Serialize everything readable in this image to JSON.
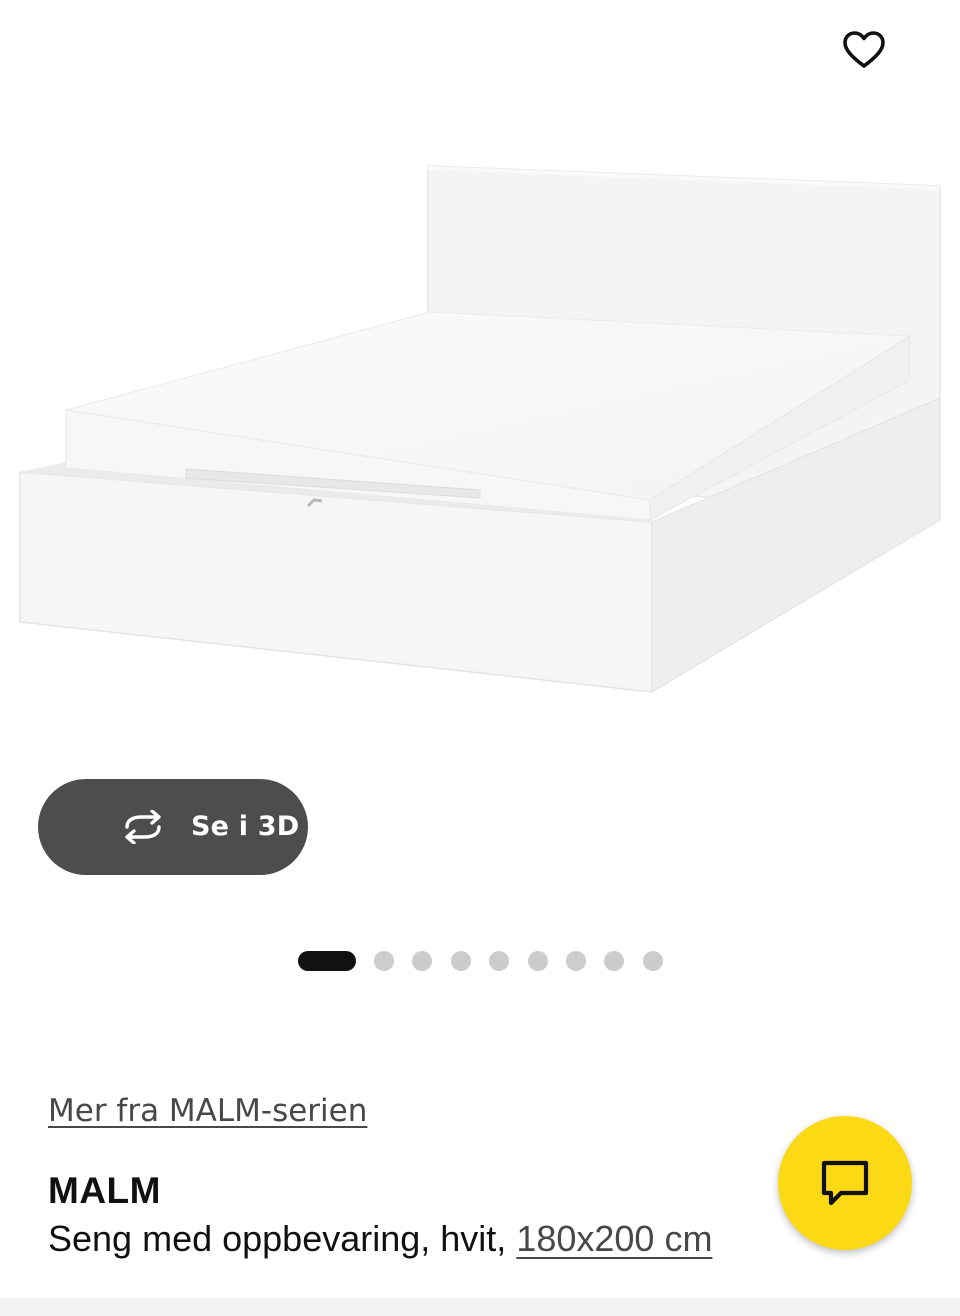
{
  "favorite": {
    "icon": "heart-outline-icon"
  },
  "viewer": {
    "label": "Se i 3D",
    "icon": "rotate-3d-icon"
  },
  "carousel": {
    "total": 9,
    "active_index": 0
  },
  "product": {
    "series_link": "Mer fra MALM-serien",
    "name": "MALM",
    "description": "Seng med oppbevaring, hvit, ",
    "size": "180x200 cm"
  },
  "chat": {
    "icon": "chat-bubble-icon",
    "color": "#fbd914"
  }
}
